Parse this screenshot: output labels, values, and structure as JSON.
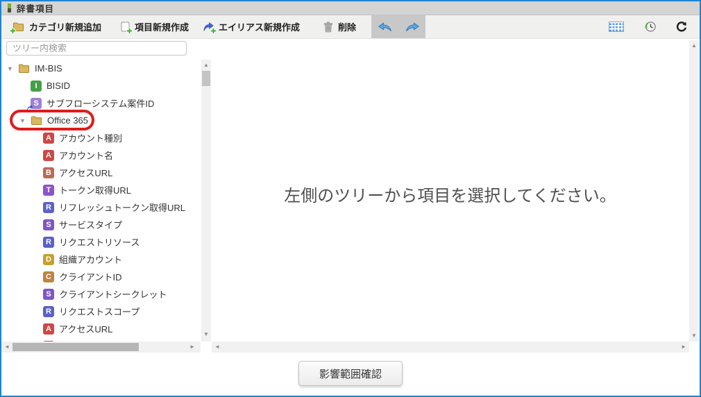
{
  "window": {
    "title": "辞書項目",
    "border_color": "#1e82cf"
  },
  "toolbar": {
    "buttons": [
      {
        "label": "カテゴリ新規追加",
        "icon": "folder-plus-icon"
      },
      {
        "label": "項目新規作成",
        "icon": "document-plus-icon"
      },
      {
        "label": "エイリアス新規作成",
        "icon": "alias-plus-icon"
      },
      {
        "label": "削除",
        "icon": "trash-icon"
      }
    ],
    "history_icons": [
      "undo-icon",
      "redo-icon"
    ],
    "right_icons": [
      "table-icon",
      "history-clock-icon",
      "refresh-icon"
    ]
  },
  "tree": {
    "search_placeholder": "ツリー内検索",
    "annotation_color": "#e01b1b",
    "items": [
      {
        "label": "IM-BIS",
        "kind": "folder",
        "indent": 0,
        "expanded": true
      },
      {
        "label": "BISID",
        "kind": "letter",
        "letter": "I",
        "color": "#43a047",
        "indent": 1
      },
      {
        "label": "サブフローシステム案件ID",
        "kind": "letter",
        "letter": "S",
        "color": "#9d7fd6",
        "alias": true,
        "indent": 1
      },
      {
        "label": "Office 365",
        "kind": "folder",
        "indent": 1,
        "expanded": true,
        "highlighted": true
      },
      {
        "label": "アカウント種別",
        "kind": "letter",
        "letter": "A",
        "color": "#ce4745",
        "indent": 2
      },
      {
        "label": "アカウント名",
        "kind": "letter",
        "letter": "A",
        "color": "#ce4745",
        "indent": 2
      },
      {
        "label": "アクセスURL",
        "kind": "letter",
        "letter": "B",
        "color": "#bd6a55",
        "indent": 2
      },
      {
        "label": "トークン取得URL",
        "kind": "letter",
        "letter": "T",
        "color": "#8e53cc",
        "indent": 2
      },
      {
        "label": "リフレッシュトークン取得URL",
        "kind": "letter",
        "letter": "R",
        "color": "#5a62c8",
        "indent": 2
      },
      {
        "label": "サービスタイプ",
        "kind": "letter",
        "letter": "S",
        "color": "#7e57c5",
        "indent": 2
      },
      {
        "label": "リクエストリソース",
        "kind": "letter",
        "letter": "R",
        "color": "#5a62c8",
        "indent": 2
      },
      {
        "label": "組織アカウント",
        "kind": "letter",
        "letter": "D",
        "color": "#c5a02e",
        "indent": 2
      },
      {
        "label": "クライアントID",
        "kind": "letter",
        "letter": "C",
        "color": "#c08440",
        "indent": 2
      },
      {
        "label": "クライアントシークレット",
        "kind": "letter",
        "letter": "S",
        "color": "#7e57c5",
        "indent": 2
      },
      {
        "label": "リクエストスコープ",
        "kind": "letter",
        "letter": "R",
        "color": "#5a62c8",
        "indent": 2
      },
      {
        "label": "アクセスURL",
        "kind": "letter",
        "letter": "A",
        "color": "#ce4745",
        "indent": 2
      },
      {
        "label": "",
        "kind": "letter",
        "letter": "",
        "color": "#ce4745",
        "indent": 2,
        "clipped": true
      }
    ]
  },
  "main": {
    "empty_message": "左側のツリーから項目を選択してください。"
  },
  "footer": {
    "impact_button_label": "影響範囲確認"
  }
}
